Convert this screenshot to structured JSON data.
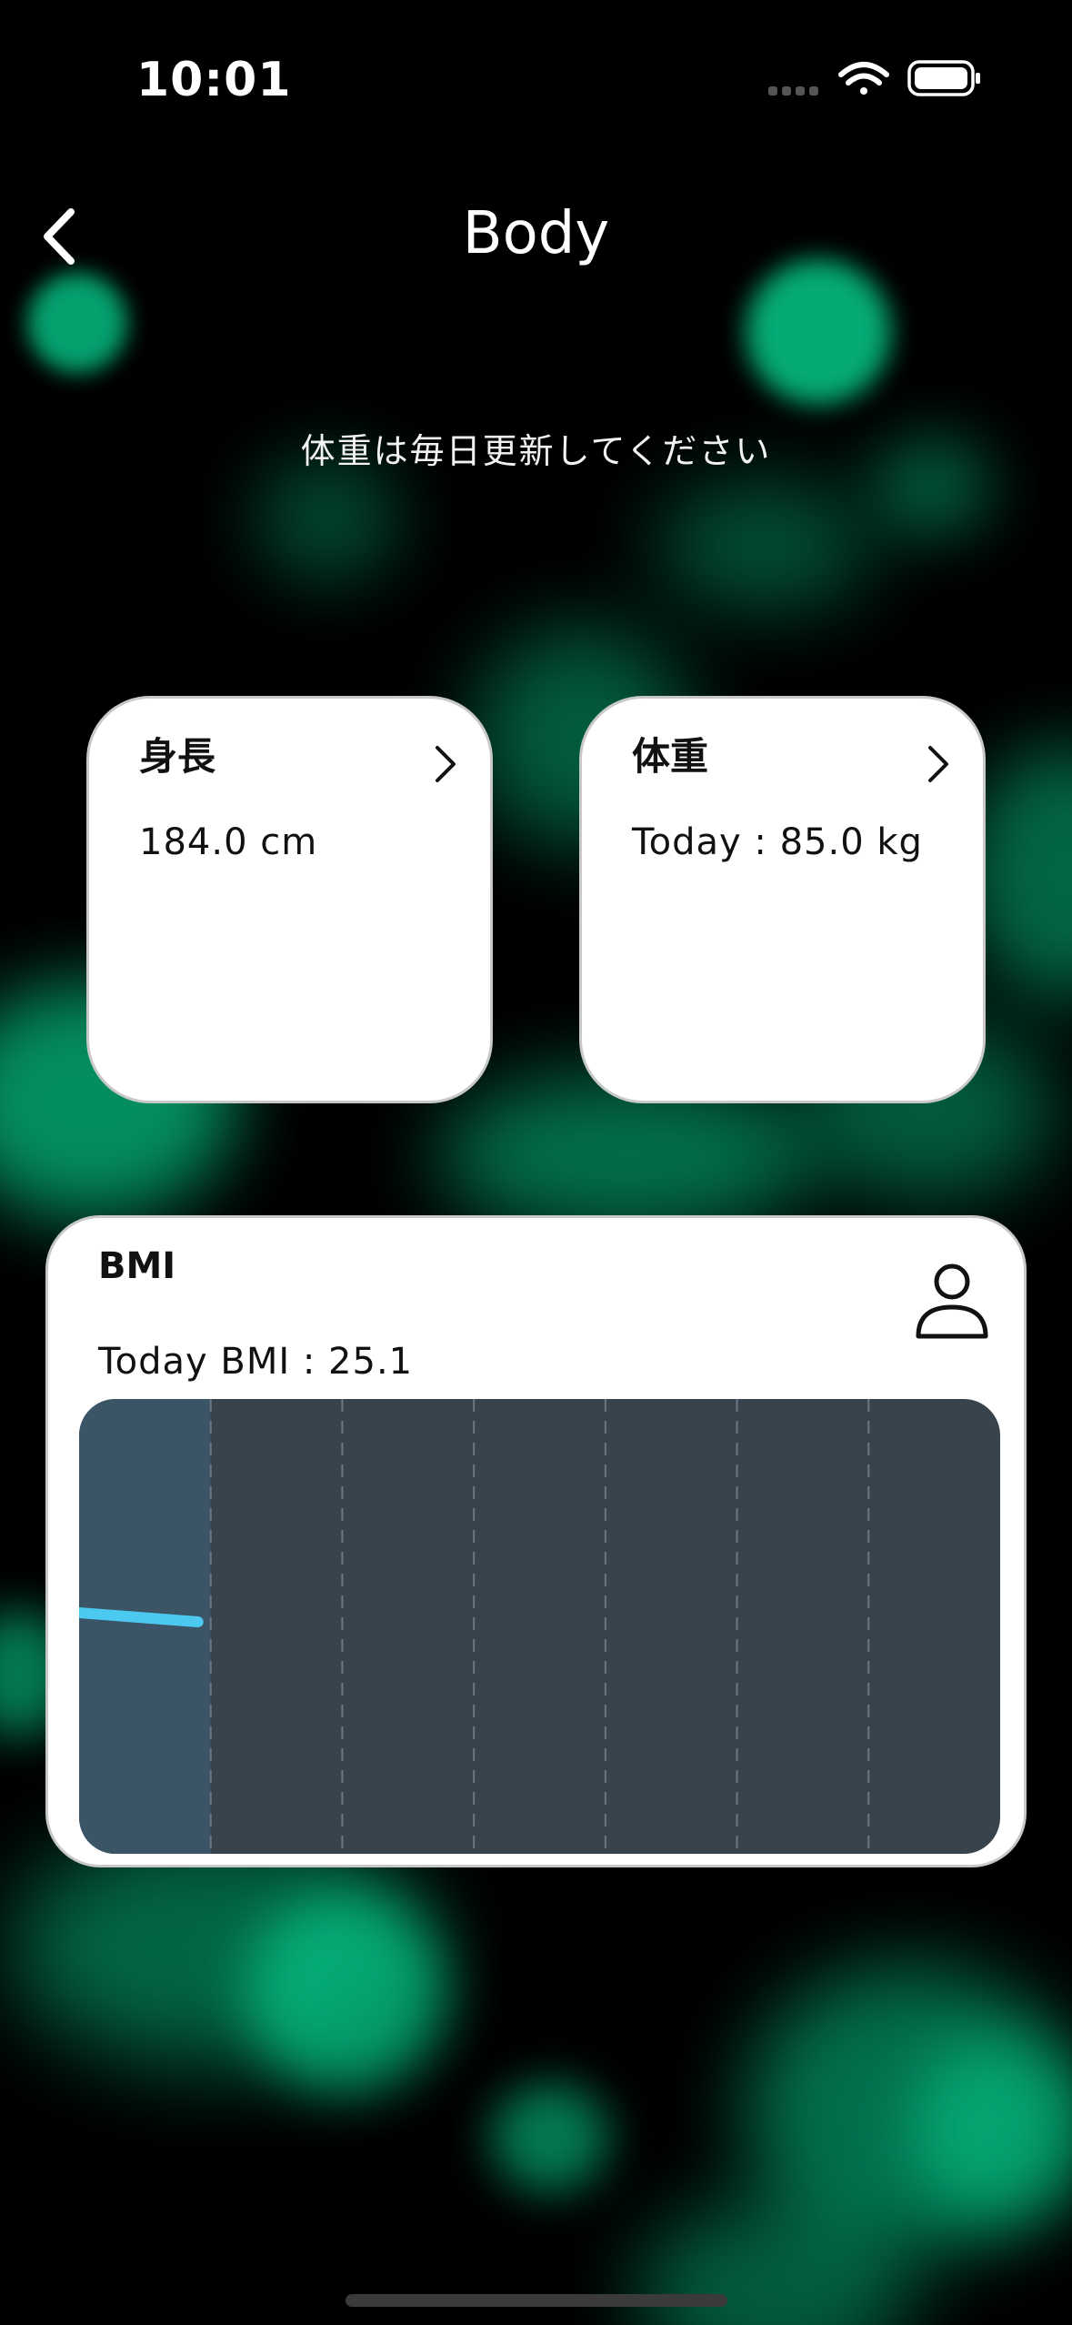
{
  "status_bar": {
    "time": "10:01",
    "icons": [
      "signal-dots-icon",
      "wifi-icon",
      "battery-icon"
    ]
  },
  "nav": {
    "back_icon": "chevron-left-icon",
    "title": "Body"
  },
  "subtitle": "体重は毎日更新してください",
  "cards": {
    "height": {
      "title": "身長",
      "value": "184.0 cm",
      "icon": "chevron-right-icon"
    },
    "weight": {
      "title": "体重",
      "value": "Today : 85.0 kg",
      "icon": "chevron-right-icon"
    }
  },
  "bmi": {
    "title": "BMI",
    "value": "Today BMI : 25.1",
    "icon": "person-icon"
  },
  "colors": {
    "background": "#000000",
    "accent_glow": "#06c98a",
    "card": "#ffffff",
    "chart_bg": "#37434d",
    "chart_highlight": "#3b5566",
    "chart_line": "#4cc9f0"
  },
  "chart_data": {
    "type": "line",
    "categories": 7,
    "gridlines": "dashed vertical",
    "series": [
      {
        "values": [
          25.3,
          25.1
        ]
      }
    ],
    "highlighted_column": 0
  }
}
